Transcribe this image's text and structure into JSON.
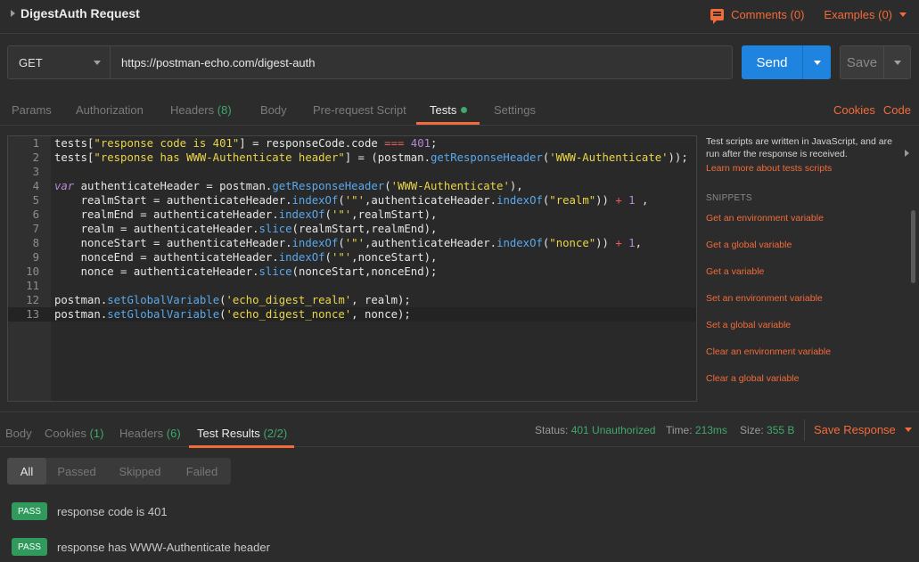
{
  "request": {
    "title": "DigestAuth Request",
    "comments_label": "Comments (0)",
    "examples_label": "Examples (0)"
  },
  "urlbar": {
    "method": "GET",
    "url": "https://postman-echo.com/digest-auth",
    "send_label": "Send",
    "save_label": "Save"
  },
  "tabs": {
    "params": "Params",
    "authorization": "Authorization",
    "headers": "Headers",
    "headers_count": "(8)",
    "body": "Body",
    "prerequest": "Pre-request Script",
    "tests": "Tests",
    "settings": "Settings",
    "cookies": "Cookies",
    "code": "Code"
  },
  "editor": {
    "line_numbers": [
      "1",
      "2",
      "3",
      "4",
      "5",
      "6",
      "7",
      "8",
      "9",
      "10",
      "11",
      "12",
      "13"
    ],
    "lines": [
      "tests[\"response code is 401\"] = responseCode.code === 401;",
      "tests[\"response has WWW-Authenticate header\"] = (postman.getResponseHeader('WWW-Authenticate'));",
      "",
      "var authenticateHeader = postman.getResponseHeader('WWW-Authenticate'),",
      "    realmStart = authenticateHeader.indexOf('\"',authenticateHeader.indexOf(\"realm\")) + 1 ,",
      "    realmEnd = authenticateHeader.indexOf('\"',realmStart),",
      "    realm = authenticateHeader.slice(realmStart,realmEnd),",
      "    nonceStart = authenticateHeader.indexOf('\"',authenticateHeader.indexOf(\"nonce\")) + 1,",
      "    nonceEnd = authenticateHeader.indexOf('\"',nonceStart),",
      "    nonce = authenticateHeader.slice(nonceStart,nonceEnd);",
      "",
      "postman.setGlobalVariable('echo_digest_realm', realm);",
      "postman.setGlobalVariable('echo_digest_nonce', nonce);"
    ]
  },
  "sidebar": {
    "description": "Test scripts are written in JavaScript, and are run after the response is received.",
    "learn_more": "Learn more about tests scripts",
    "snippets_title": "SNIPPETS",
    "snippets": [
      "Get an environment variable",
      "Get a global variable",
      "Get a variable",
      "Set an environment variable",
      "Set a global variable",
      "Clear an environment variable",
      "Clear a global variable"
    ]
  },
  "response": {
    "tabs": {
      "body": "Body",
      "cookies": "Cookies",
      "cookies_count": "(1)",
      "headers": "Headers",
      "headers_count": "(6)",
      "test_results": "Test Results",
      "test_results_count": "(2/2)"
    },
    "status_label": "Status:",
    "status_value": "401 Unauthorized",
    "time_label": "Time:",
    "time_value": "213ms",
    "size_label": "Size:",
    "size_value": "355 B",
    "save_response": "Save Response",
    "filters": [
      "All",
      "Passed",
      "Skipped",
      "Failed"
    ],
    "results": [
      {
        "badge": "PASS",
        "text": "response code is 401"
      },
      {
        "badge": "PASS",
        "text": "response has WWW-Authenticate header"
      }
    ]
  },
  "colors": {
    "accent": "#f26b3a",
    "send_blue": "#1f84e0",
    "pass_green": "#2f9a5b",
    "count_green": "#3fa86b"
  }
}
